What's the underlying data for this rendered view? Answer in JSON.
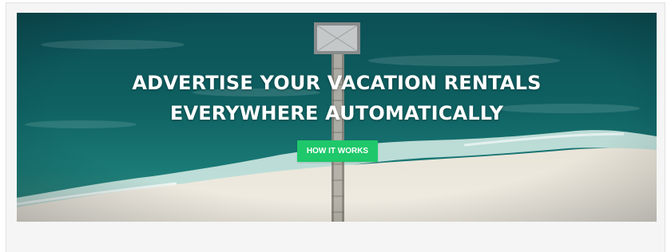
{
  "hero": {
    "headline_line_1": "ADVERTISE YOUR VACATION RENTALS",
    "headline_line_2": "EVERYWHERE AUTOMATICALLY",
    "cta_label": "HOW IT WORKS",
    "background": "aerial-beach-pier-photo"
  },
  "colors": {
    "sea": "#0f5d5f",
    "sand": "#ece7dc",
    "cta": "#1fc86a",
    "text": "#ffffff",
    "page_background": "#f5f5f5"
  }
}
